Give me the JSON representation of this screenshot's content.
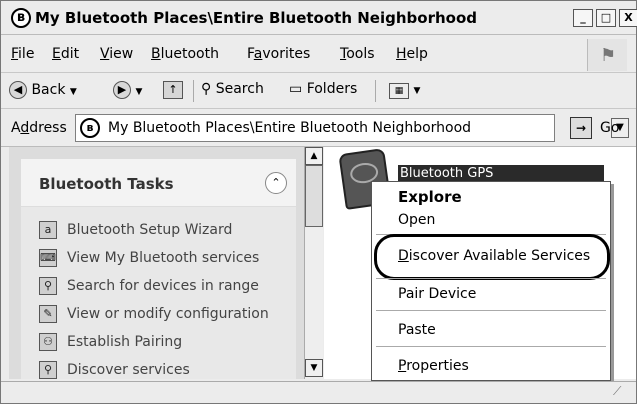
{
  "window": {
    "title": "My Bluetooth Places\\Entire Bluetooth Neighborhood",
    "title_icon": "bluetooth-icon",
    "controls": {
      "minimize": "_",
      "maximize": "□",
      "close": "X"
    }
  },
  "menubar": {
    "items": [
      {
        "label": "File",
        "u": "F",
        "rest": "ile"
      },
      {
        "label": "Edit",
        "u": "E",
        "rest": "dit"
      },
      {
        "label": "View",
        "u": "V",
        "rest": "iew"
      },
      {
        "label": "Bluetooth",
        "u": "B",
        "rest": "luetooth"
      },
      {
        "label": "Favorites",
        "pre": "F",
        "u": "a",
        "rest": "vorites"
      },
      {
        "label": "Tools",
        "u": "T",
        "rest": "ools"
      },
      {
        "label": "Help",
        "u": "H",
        "rest": "elp"
      }
    ]
  },
  "toolbar": {
    "back": "Back",
    "search": "Search",
    "folders": "Folders"
  },
  "address": {
    "label_pre": "A",
    "label_u": "d",
    "label_rest": "dress",
    "path": "My Bluetooth Places\\Entire Bluetooth Neighborhood",
    "go": "Go"
  },
  "tasks": {
    "title": "Bluetooth Tasks",
    "items": [
      {
        "label": "Bluetooth Setup Wizard",
        "icon": "wizard-icon"
      },
      {
        "label": "View My Bluetooth services",
        "icon": "services-icon"
      },
      {
        "label": "Search for devices in range",
        "icon": "search-icon"
      },
      {
        "label": "View or modify configuration",
        "icon": "configuration-icon"
      },
      {
        "label": "Establish Pairing",
        "icon": "pairing-icon"
      },
      {
        "label": "Discover services",
        "icon": "discover-icon"
      }
    ]
  },
  "device": {
    "label": "Bluetooth GPS",
    "icon": "gps-device-icon"
  },
  "context_menu": {
    "items": [
      {
        "label": "Explore",
        "bold": true
      },
      {
        "label": "Open"
      },
      {
        "label": "Discover Available Services",
        "u": "D",
        "rest": "iscover Available Services"
      },
      {
        "label": "Pair Device"
      },
      {
        "label": "Paste"
      },
      {
        "label": "Properties",
        "u": "P",
        "rest": "roperties"
      }
    ]
  }
}
